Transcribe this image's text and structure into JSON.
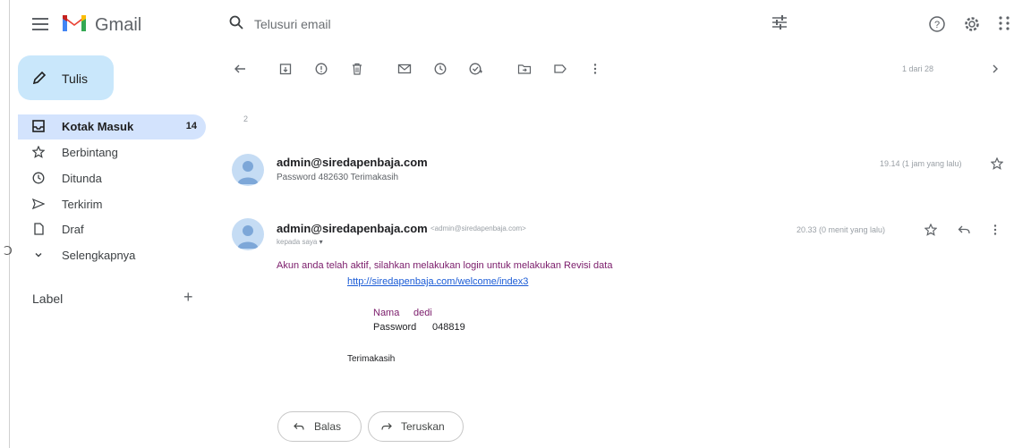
{
  "app": {
    "brand": "Gmail"
  },
  "search": {
    "placeholder": "Telusuri email"
  },
  "compose": {
    "label": "Tulis"
  },
  "sidebar": {
    "items": [
      {
        "label": "Kotak Masuk",
        "count": "14",
        "icon": "inbox-icon",
        "active": true
      },
      {
        "label": "Berbintang",
        "icon": "star-icon"
      },
      {
        "label": "Ditunda",
        "icon": "clock-icon"
      },
      {
        "label": "Terkirim",
        "icon": "send-icon"
      },
      {
        "label": "Draf",
        "icon": "file-icon"
      },
      {
        "label": "Selengkapnya",
        "icon": "chevron-down-icon"
      }
    ],
    "labels_heading": "Label",
    "labels_add": "+"
  },
  "toolbar": {
    "page_count": "1 dari 28"
  },
  "thread": {
    "count": "2"
  },
  "messages": [
    {
      "sender": "admin@siredapenbaja.com",
      "snippet": "Password  482630 Terimakasih",
      "time": "19.14 (1 jam yang lalu)"
    },
    {
      "sender": "admin@siredapenbaja.com",
      "sender_email": "<admin@siredapenbaja.com>",
      "to": "kepada saya",
      "time": "20.33 (0 menit yang lalu)",
      "body": {
        "line1": "Akun anda telah aktif, silahkan melakukan login untuk melakukan Revisi data",
        "link": "http://siredapenbaja.com/welcome/index3",
        "nama_label": "Nama",
        "nama_value": "dedi",
        "password_label": "Password",
        "password_value": "048819",
        "closing": "Terimakasih"
      }
    }
  ],
  "actions": {
    "reply": "Balas",
    "forward": "Teruskan"
  },
  "colors": {
    "compose_bg": "#c9e7fb",
    "active_nav": "#d3e3fd",
    "body_text": "#7a1b6a",
    "link": "#1a5bd6"
  }
}
